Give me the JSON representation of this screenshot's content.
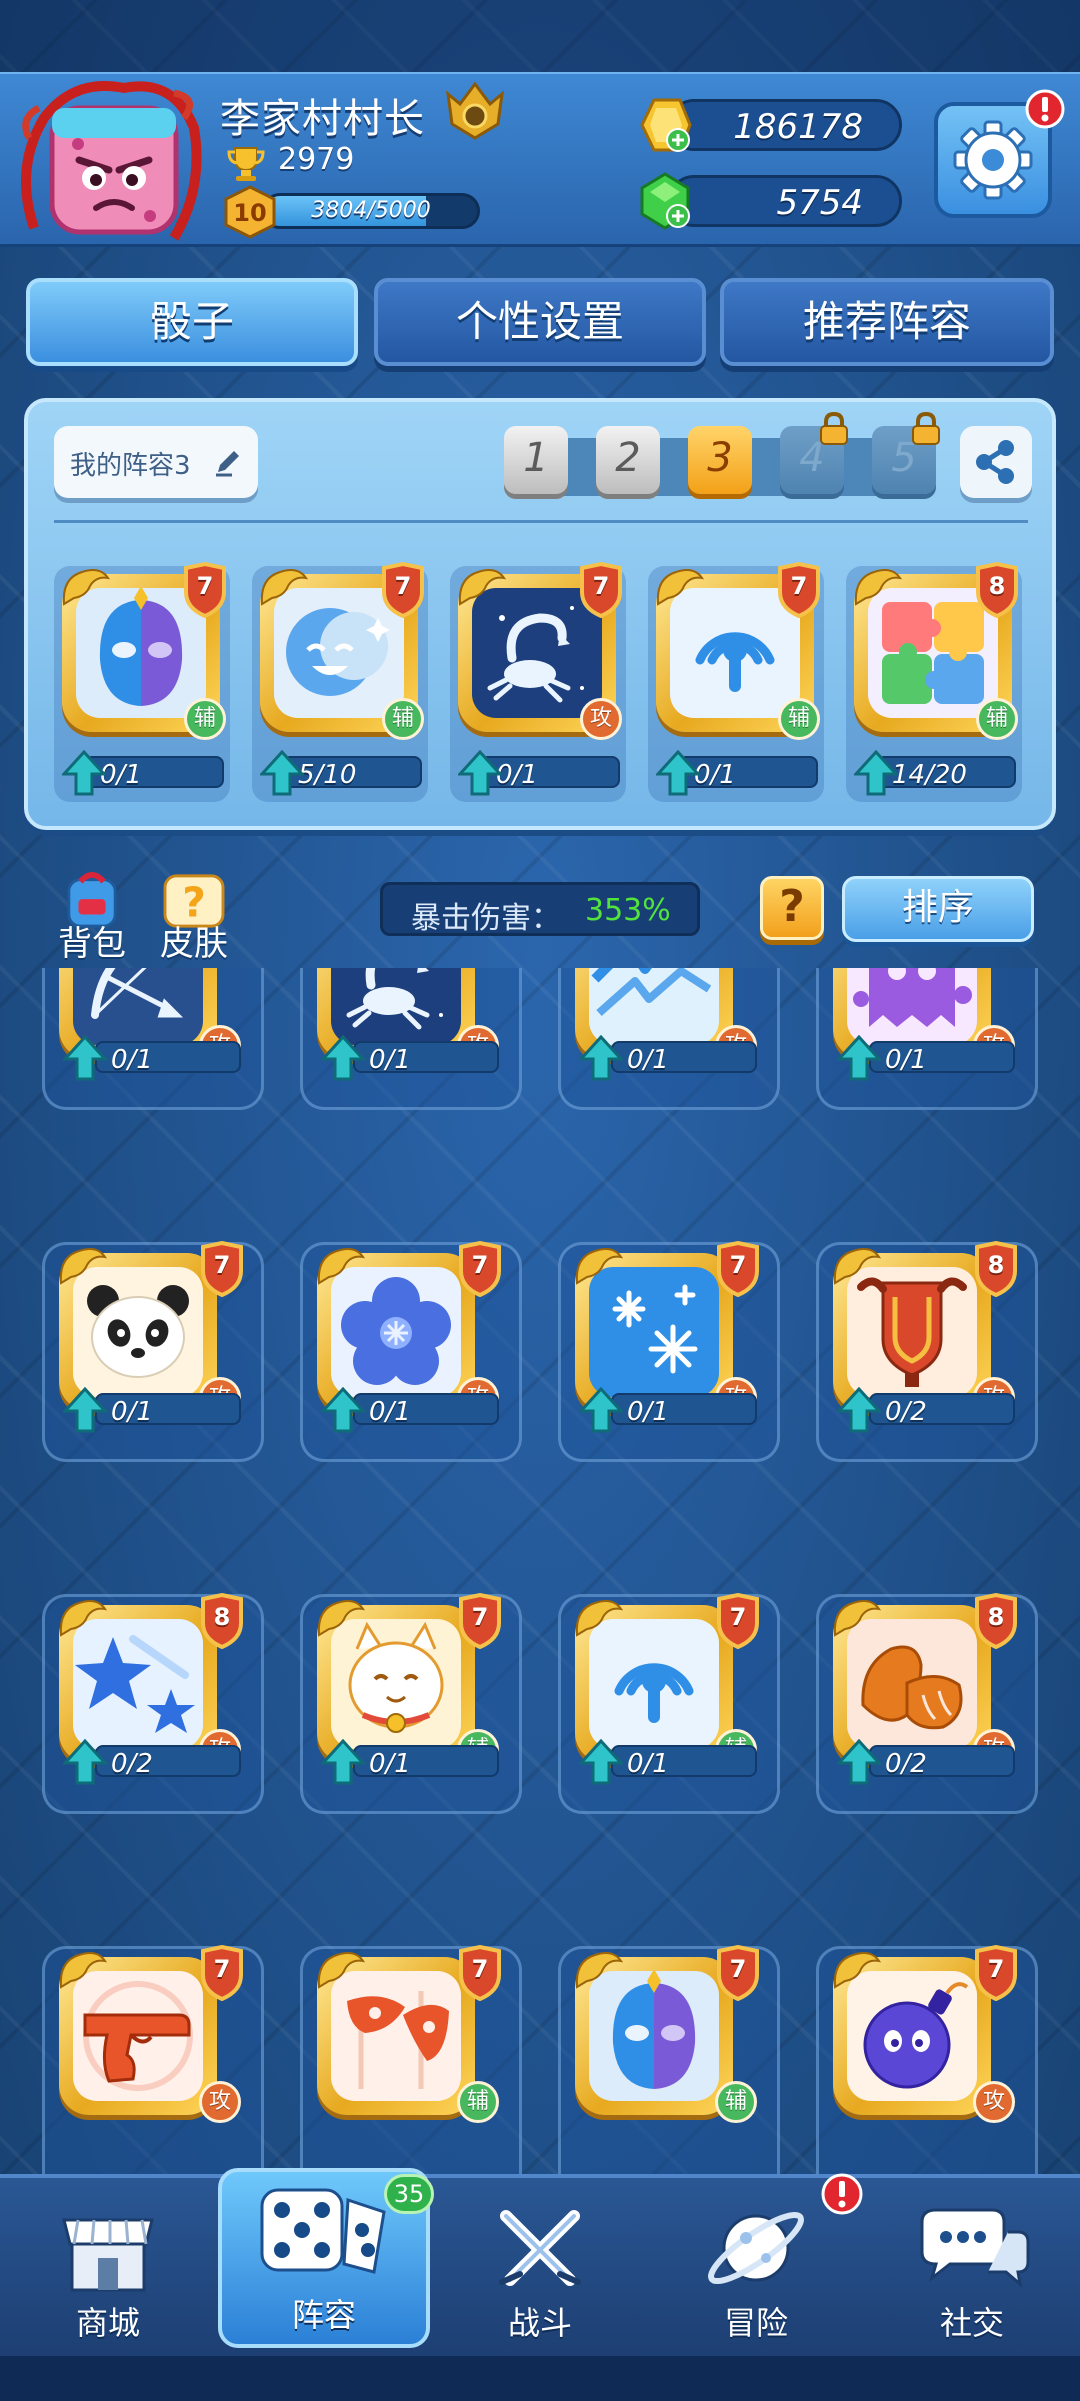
{
  "header": {
    "player_name": "李家村村长",
    "trophies": "2979",
    "level": "10",
    "xp_text": "3804/5000",
    "xp_fraction": 0.76,
    "gold": "186178",
    "gems": "5754"
  },
  "tabs": [
    {
      "label": "骰子",
      "active": true
    },
    {
      "label": "个性设置",
      "active": false
    },
    {
      "label": "推荐阵容",
      "active": false
    }
  ],
  "deck": {
    "name": "我的阵容3",
    "slots": [
      {
        "label": "1",
        "state": "normal"
      },
      {
        "label": "2",
        "state": "normal"
      },
      {
        "label": "3",
        "state": "selected"
      },
      {
        "label": "4",
        "state": "locked"
      },
      {
        "label": "5",
        "state": "locked"
      }
    ],
    "cards": [
      {
        "icon": "split-face-icon",
        "level": "7",
        "role": "辅",
        "progress": "0/1"
      },
      {
        "icon": "two-faces-icon",
        "level": "7",
        "role": "辅",
        "progress": "5/10"
      },
      {
        "icon": "scorpion-icon",
        "level": "7",
        "role": "攻",
        "progress": "0/1"
      },
      {
        "icon": "signal-icon",
        "level": "7",
        "role": "辅",
        "progress": "0/1"
      },
      {
        "icon": "puzzle-icon",
        "level": "8",
        "role": "辅",
        "progress": "14/20"
      }
    ]
  },
  "controls": {
    "bag_label": "背包",
    "skin_label": "皮肤",
    "crit_label": "暴击伤害：",
    "crit_value": "353%",
    "help_label": "?",
    "sort_label": "排序"
  },
  "grid": [
    {
      "icon": "bow-icon",
      "level": "",
      "role": "攻",
      "progress": "0/1"
    },
    {
      "icon": "scorpion-icon",
      "level": "",
      "role": "攻",
      "progress": "0/1"
    },
    {
      "icon": "lightning-icon",
      "level": "",
      "role": "攻",
      "progress": "0/1"
    },
    {
      "icon": "ghost-icon",
      "level": "",
      "role": "攻",
      "progress": "0/1"
    },
    {
      "icon": "panda-icon",
      "level": "7",
      "role": "攻",
      "progress": "0/1"
    },
    {
      "icon": "flower-icon",
      "level": "7",
      "role": "攻",
      "progress": "0/1"
    },
    {
      "icon": "snowflake-icon",
      "level": "7",
      "role": "攻",
      "progress": "0/1"
    },
    {
      "icon": "shield-banner-icon",
      "level": "8",
      "role": "攻",
      "progress": "0/2"
    },
    {
      "icon": "stars-icon",
      "level": "8",
      "role": "攻",
      "progress": "0/2"
    },
    {
      "icon": "lucky-cat-icon",
      "level": "7",
      "role": "辅",
      "progress": "0/1"
    },
    {
      "icon": "signal-icon",
      "level": "7",
      "role": "辅",
      "progress": "0/1"
    },
    {
      "icon": "bread-icon",
      "level": "8",
      "role": "攻",
      "progress": "0/2"
    },
    {
      "icon": "gun-icon",
      "level": "7",
      "role": "攻",
      "progress": ""
    },
    {
      "icon": "mask-flag-icon",
      "level": "7",
      "role": "辅",
      "progress": ""
    },
    {
      "icon": "split-face-icon",
      "level": "7",
      "role": "辅",
      "progress": ""
    },
    {
      "icon": "bomb-icon",
      "level": "7",
      "role": "攻",
      "progress": ""
    }
  ],
  "nav": {
    "shop": "商城",
    "deck": "阵容",
    "deck_badge": "35",
    "battle": "战斗",
    "adventure": "冒险",
    "social": "社交"
  }
}
